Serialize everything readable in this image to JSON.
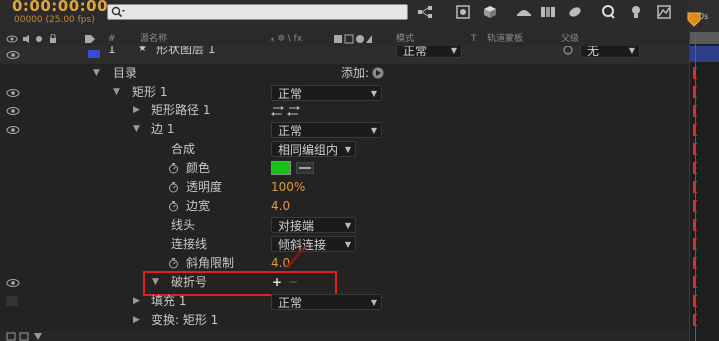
{
  "header": {
    "timecode": "0:00:00:00",
    "frame_info": "00000 (25.00 fps)",
    "search_placeholder": "",
    "ruler_label": "0s"
  },
  "columns": {
    "hash": "#",
    "source_name": "源名称",
    "switches": "⁎ ✲ \\ fx",
    "mode": "模式",
    "t": "T",
    "trkmat": "轨道蒙板",
    "parent": "父级"
  },
  "layer": {
    "index": "1",
    "star": "★",
    "name": "形状图层 1",
    "mode": "正常",
    "parent_value": "无",
    "label_color": "#3a4bd0"
  },
  "tree": {
    "contents_label": "目录",
    "add_label": "添加:",
    "rect_label": "矩形 1",
    "rect_mode": "正常",
    "rect_path_label": "矩形路径 1",
    "stroke_label": "边 1",
    "stroke_mode": "正常",
    "composite_label": "合成",
    "composite_value": "相同编组内",
    "color_label": "颜色",
    "color_value": "#16c316",
    "opacity_label": "透明度",
    "opacity_value": "100%",
    "width_label": "边宽",
    "width_value": "4.0",
    "cap_label": "线头",
    "cap_value": "对接端",
    "join_label": "连接线",
    "join_value": "倾斜连接",
    "miter_label": "斜角限制",
    "miter_value": "4.0",
    "dash_label": "破折号",
    "dash_plus": "+",
    "dash_minus": "−",
    "fill_label": "填充 1",
    "fill_mode": "正常",
    "transform_label": "变换: 矩形 1"
  },
  "colors": {
    "highlight_box": "#e02020",
    "timeline_marker": "#e08a1a",
    "playhead": "#d03030"
  }
}
